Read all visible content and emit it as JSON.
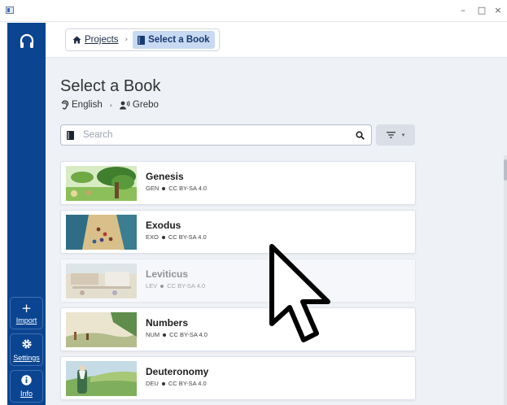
{
  "window": {
    "min_glyph": "–",
    "max_glyph": "□",
    "close_glyph": "×"
  },
  "sidebar": {
    "import_label": "Import",
    "import_glyph": "+",
    "settings_label": "Settings",
    "info_label": "Info"
  },
  "breadcrumb": {
    "projects": "Projects",
    "separator": "›",
    "current": "Select a Book"
  },
  "main": {
    "title": "Select a Book",
    "source_language": "English",
    "lang_separator": "›",
    "target_language": "Grebo",
    "search_placeholder": "Search",
    "filter_caret": "▾"
  },
  "books": [
    {
      "name": "Genesis",
      "code": "GEN",
      "license": "CC BY-SA 4.0",
      "enabled": true
    },
    {
      "name": "Exodus",
      "code": "EXO",
      "license": "CC BY-SA 4.0",
      "enabled": true
    },
    {
      "name": "Leviticus",
      "code": "LEV",
      "license": "CC BY-SA 4.0",
      "enabled": false
    },
    {
      "name": "Numbers",
      "code": "NUM",
      "license": "CC BY-SA 4.0",
      "enabled": true
    },
    {
      "name": "Deuteronomy",
      "code": "DEU",
      "license": "CC BY-SA 4.0",
      "enabled": true
    }
  ],
  "colors": {
    "sidebar": "#0b4592",
    "crumb_active_bg": "#c8d9f2",
    "main_bg": "#eef1f6"
  }
}
